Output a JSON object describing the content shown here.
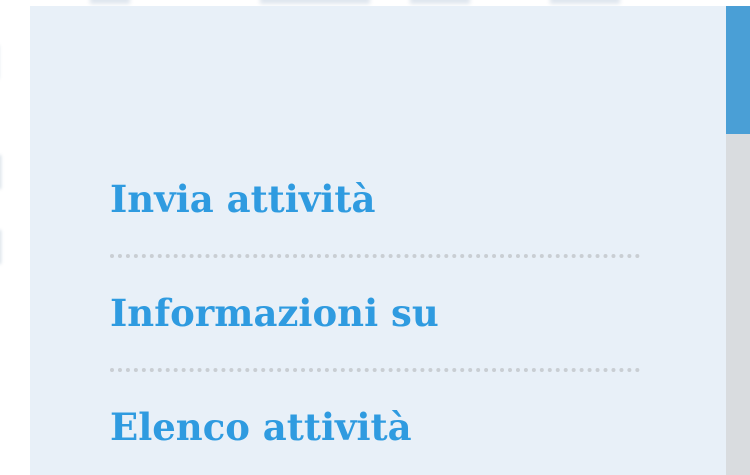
{
  "menu": {
    "items": [
      {
        "label": "Invia attività"
      },
      {
        "label": "Informazioni su"
      },
      {
        "label": "Elenco attività"
      }
    ]
  },
  "colors": {
    "panel_background": "#e8f0f8",
    "link": "#2f9be0",
    "divider": "#c9ced3",
    "scrollbar_track": "#d9dcdf",
    "scrollbar_thumb": "#4a9fd6"
  }
}
